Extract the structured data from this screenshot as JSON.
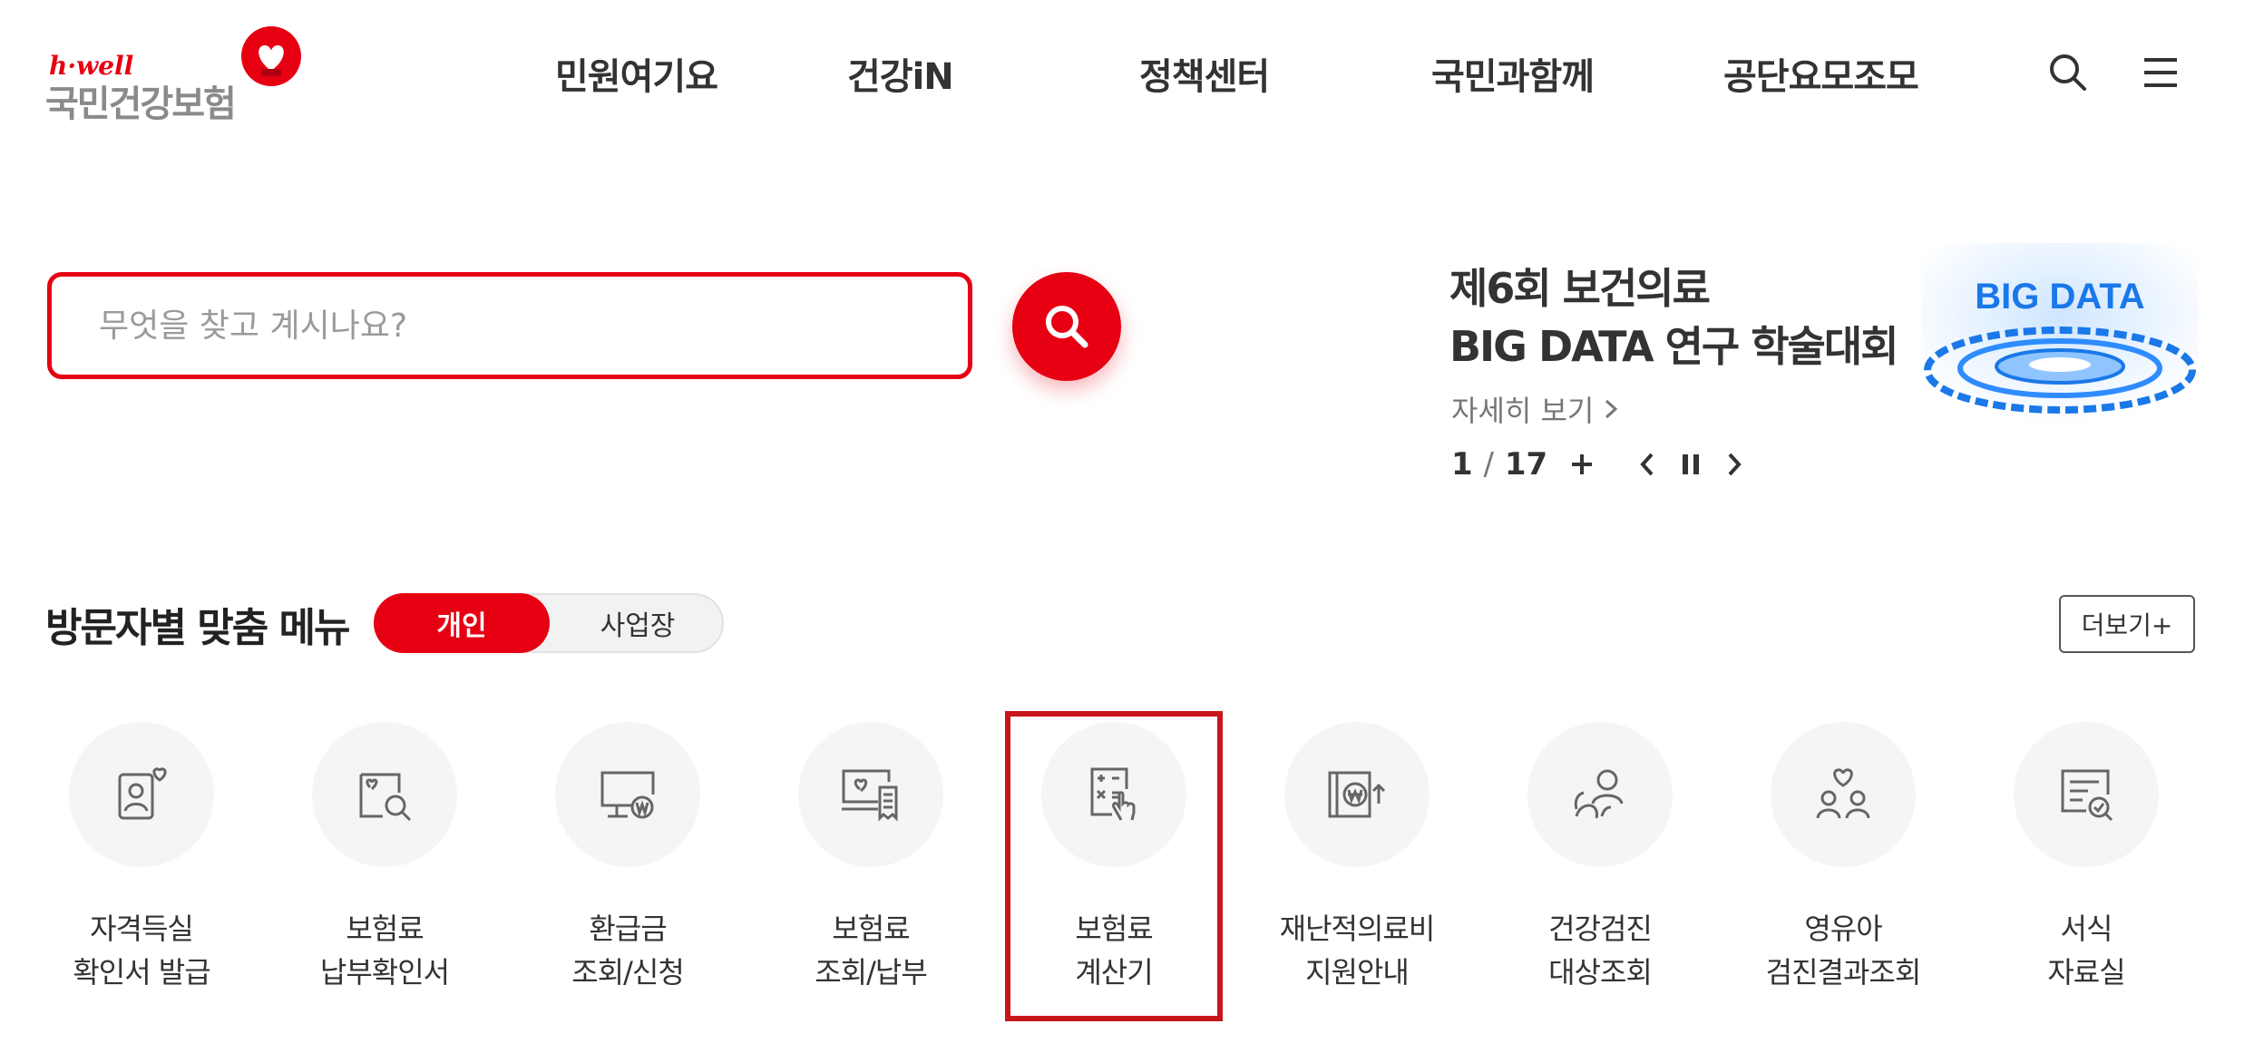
{
  "header": {
    "logo_sub": "h·well",
    "logo_main": "국민건강보험",
    "nav": [
      "민원여기요",
      "건강iN",
      "정책센터",
      "국민과함께",
      "공단요모조모"
    ],
    "search_icon": "search-icon",
    "menu_icon": "hamburger-menu-icon"
  },
  "search": {
    "placeholder": "무엇을 찾고 계시나요?",
    "button_icon": "search-icon"
  },
  "banner": {
    "title_line1": "제6회 보건의료",
    "title_line2": "BIG DATA 연구 학술대회",
    "more_label": "자세히 보기",
    "image_text": "BIG DATA",
    "current": "1",
    "separator": "/",
    "total": "17"
  },
  "custom_menu": {
    "title": "방문자별 맞춤 메뉴",
    "toggle": [
      "개인",
      "사업장"
    ],
    "selected": "개인",
    "more_label": "더보기+",
    "items": [
      {
        "line1": "자격득실",
        "line2": "확인서 발급",
        "icon": "id-card-heart-icon"
      },
      {
        "line1": "보험료",
        "line2": "납부확인서",
        "icon": "document-search-icon"
      },
      {
        "line1": "환급금",
        "line2": "조회/신청",
        "icon": "monitor-won-icon"
      },
      {
        "line1": "보험료",
        "line2": "조회/납부",
        "icon": "monitor-receipt-icon"
      },
      {
        "line1": "보험료",
        "line2": "계산기",
        "icon": "calculator-touch-icon"
      },
      {
        "line1": "재난적의료비",
        "line2": "지원안내",
        "icon": "book-won-icon"
      },
      {
        "line1": "건강검진",
        "line2": "대상조회",
        "icon": "people-check-icon"
      },
      {
        "line1": "영유아",
        "line2": "검진결과조회",
        "icon": "family-heart-icon"
      },
      {
        "line1": "서식",
        "line2": "자료실",
        "icon": "form-search-icon"
      }
    ]
  },
  "colors": {
    "brand_red": "#e60012",
    "highlight": "#c8161d",
    "icon_gray": "#666666"
  }
}
